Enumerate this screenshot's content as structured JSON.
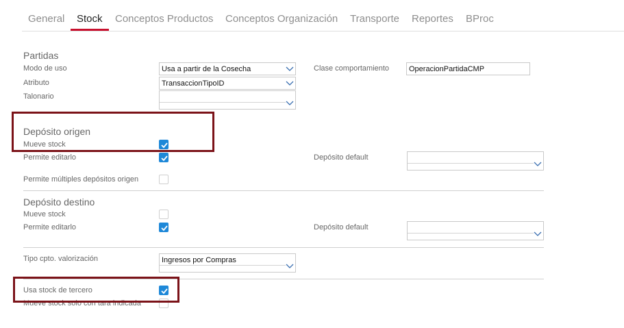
{
  "tabs": [
    {
      "label": "General",
      "active": false
    },
    {
      "label": "Stock",
      "active": true
    },
    {
      "label": "Conceptos Productos",
      "active": false
    },
    {
      "label": "Conceptos Organización",
      "active": false
    },
    {
      "label": "Transporte",
      "active": false
    },
    {
      "label": "Reportes",
      "active": false
    },
    {
      "label": "BProc",
      "active": false
    }
  ],
  "partidas": {
    "title": "Partidas",
    "modo_uso_label": "Modo de uso",
    "modo_uso_value": "Usa a partir de la Cosecha",
    "atributo_label": "Atributo",
    "atributo_value": "TransaccionTipoID",
    "talonario_label": "Talonario",
    "talonario_value": "",
    "clase_label": "Clase comportamiento",
    "clase_value": "OperacionPartidaCMP"
  },
  "deposito_origen": {
    "title": "Depósito origen",
    "mueve_stock_label": "Mueve stock",
    "mueve_stock_checked": true,
    "permite_editarlo_label": "Permite editarlo",
    "permite_editarlo_checked": true,
    "deposito_default_label": "Depósito default",
    "deposito_default_value": "",
    "multiples_label": "Permite múltiples depósitos origen",
    "multiples_checked": false
  },
  "deposito_destino": {
    "title": "Depósito destino",
    "mueve_stock_label": "Mueve stock",
    "mueve_stock_checked": false,
    "permite_editarlo_label": "Permite editarlo",
    "permite_editarlo_checked": true,
    "deposito_default_label": "Depósito default",
    "deposito_default_value": ""
  },
  "valorizacion": {
    "tipo_label": "Tipo cpto. valorización",
    "tipo_value": "Ingresos por Compras"
  },
  "tercero": {
    "usa_stock_label": "Usa stock de tercero",
    "usa_stock_checked": true,
    "mueve_tara_label": "Mueve stock solo con tara indicada",
    "mueve_tara_checked": false
  },
  "colors": {
    "accent": "#c8102e",
    "checkbox": "#1e88d8",
    "highlight": "#7b1218"
  }
}
